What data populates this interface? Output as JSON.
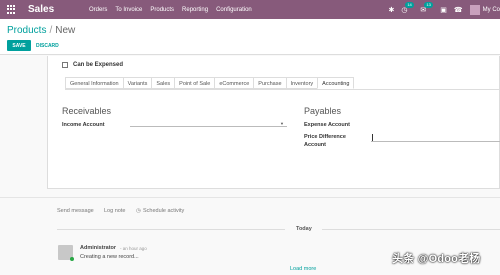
{
  "navbar": {
    "app_name": "Sales",
    "menu": [
      "Orders",
      "To Invoice",
      "Products",
      "Reporting",
      "Configuration"
    ],
    "badges": {
      "activities": "14",
      "messages": "13"
    },
    "user": "My Co"
  },
  "breadcrumb": {
    "parent": "Products",
    "current": "New"
  },
  "buttons": {
    "save": "SAVE",
    "discard": "DISCARD"
  },
  "form": {
    "can_be_expensed_label": "Can be Expensed",
    "tabs": [
      "General Information",
      "Variants",
      "Sales",
      "Point of Sale",
      "eCommerce",
      "Purchase",
      "Inventory",
      "Accounting"
    ],
    "active_tab": "Accounting",
    "receivables": {
      "title": "Receivables",
      "income_account_label": "Income Account"
    },
    "payables": {
      "title": "Payables",
      "expense_account_label": "Expense Account",
      "price_difference_label_1": "Price Difference",
      "price_difference_label_2": "Account"
    }
  },
  "chatter": {
    "send_message": "Send message",
    "log_note": "Log note",
    "schedule_activity": "Schedule activity",
    "today": "Today",
    "message": {
      "author": "Administrator",
      "time": "- an hour ago",
      "body": "Creating a new record..."
    },
    "load_more": "Load more"
  },
  "watermark": "头条 @Odoo老杨",
  "colors": {
    "brand": "#875a7b",
    "accent": "#00a09d"
  }
}
